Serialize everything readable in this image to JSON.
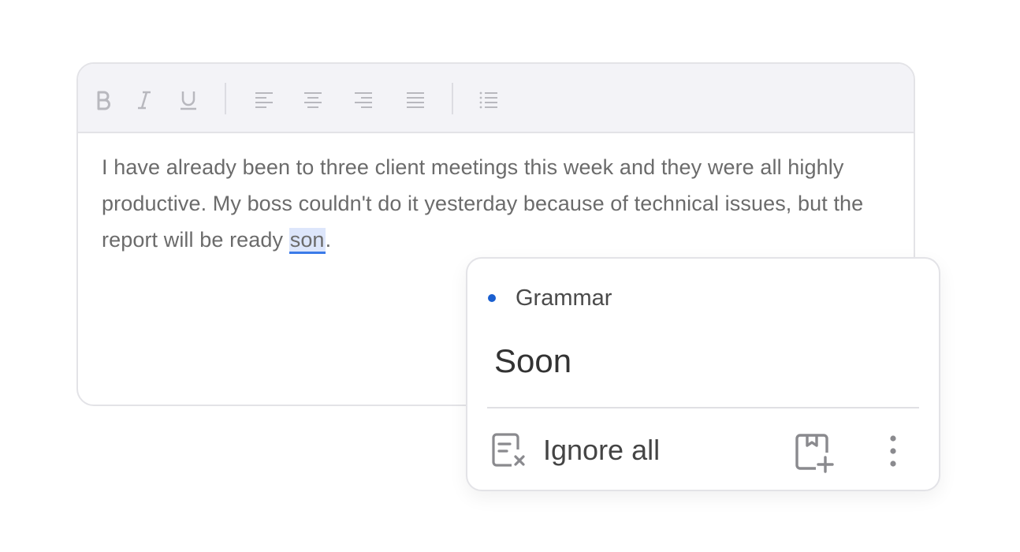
{
  "editor": {
    "toolbar": {
      "buttons": [
        {
          "name": "bold",
          "icon": "bold-icon"
        },
        {
          "name": "italic",
          "icon": "italic-icon"
        },
        {
          "name": "underline",
          "icon": "underline-icon"
        },
        {
          "name": "align-left",
          "icon": "align-left-icon"
        },
        {
          "name": "align-center",
          "icon": "align-center-icon"
        },
        {
          "name": "align-right",
          "icon": "align-right-icon"
        },
        {
          "name": "align-justify",
          "icon": "align-justify-icon"
        },
        {
          "name": "bulleted-list",
          "icon": "list-icon"
        }
      ]
    },
    "text_before": "I have already been to three client meetings this week and they were all highly productive. My boss couldn't do it yesterday because of technical issues, but the report will be ready ",
    "error_word": "son",
    "text_after": "."
  },
  "popup": {
    "category": "Grammar",
    "category_color": "#1a5fd0",
    "suggestion": "Soon",
    "ignore_all_label": "Ignore all",
    "ignore_icon": "ignore-document-icon",
    "add_dictionary_icon": "add-to-dictionary-icon",
    "more_icon": "more-vertical-icon"
  },
  "colors": {
    "highlight_bg": "#dde6fb",
    "highlight_underline": "#3b7be8",
    "toolbar_bg": "#f3f3f7"
  }
}
